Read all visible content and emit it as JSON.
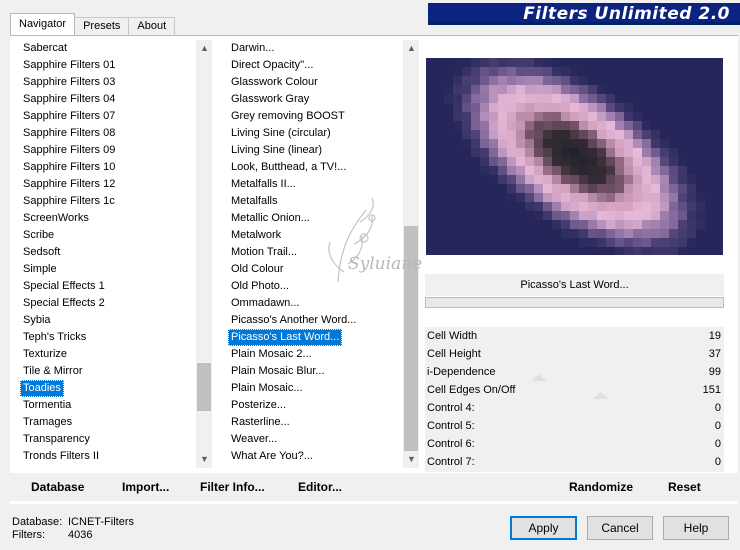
{
  "tabs": [
    "Navigator",
    "Presets",
    "About"
  ],
  "title": "Filters Unlimited 2.0",
  "categories": [
    "Sabercat",
    "Sapphire Filters 01",
    "Sapphire Filters 03",
    "Sapphire Filters 04",
    "Sapphire Filters 07",
    "Sapphire Filters 08",
    "Sapphire Filters 09",
    "Sapphire Filters 10",
    "Sapphire Filters 12",
    "Sapphire Filters 1c",
    "ScreenWorks",
    "Scribe",
    "Sedsoft",
    "Simple",
    "Special Effects 1",
    "Special Effects 2",
    "Sybia",
    "Teph's Tricks",
    "Texturize",
    "Tile & Mirror",
    "Toadies",
    "Tormentia",
    "Tramages",
    "Transparency",
    "Tronds Filters II"
  ],
  "selected_category": "Toadies",
  "filters": [
    "Darwin...",
    "Direct Opacity''...",
    "Glasswork Colour",
    "Glasswork Gray",
    "Grey removing BOOST",
    "Living Sine (circular)",
    "Living Sine (linear)",
    "Look, Butthead, a TV!...",
    "Metalfalls II...",
    "Metalfalls",
    "Metallic Onion...",
    "Metalwork",
    "Motion Trail...",
    "Old Colour",
    "Old Photo...",
    "Ommadawn...",
    "Picasso's Another Word...",
    "Picasso's Last Word...",
    "Plain Mosaic 2...",
    "Plain Mosaic Blur...",
    "Plain Mosaic...",
    "Posterize...",
    "Rasterline...",
    "Weaver...",
    "What Are You?..."
  ],
  "selected_filter": "Picasso's Last Word...",
  "filter_title": "Picasso's Last Word...",
  "params": [
    {
      "name": "Cell Width",
      "value": "19"
    },
    {
      "name": "Cell Height",
      "value": "37"
    },
    {
      "name": "i-Dependence",
      "value": "99"
    },
    {
      "name": "Cell Edges On/Off",
      "value": "151"
    },
    {
      "name": "Control 4:",
      "value": "0"
    },
    {
      "name": "Control 5:",
      "value": "0"
    },
    {
      "name": "Control 6:",
      "value": "0"
    },
    {
      "name": "Control 7:",
      "value": "0"
    }
  ],
  "toolbar": {
    "database": "Database",
    "import": "Import...",
    "filter_info": "Filter Info...",
    "editor": "Editor...",
    "randomize": "Randomize",
    "reset": "Reset"
  },
  "info": {
    "database_label": "Database:",
    "database_value": "ICNET-Filters",
    "filters_label": "Filters:",
    "filters_value": "4036"
  },
  "buttons": {
    "apply": "Apply",
    "cancel": "Cancel",
    "help": "Help"
  },
  "watermark": "Syluiane",
  "colors": {
    "banner": "#0c2380",
    "selection": "#0078d7",
    "preview_dark": "#26265a",
    "preview_pink": "#e8b8d8"
  }
}
